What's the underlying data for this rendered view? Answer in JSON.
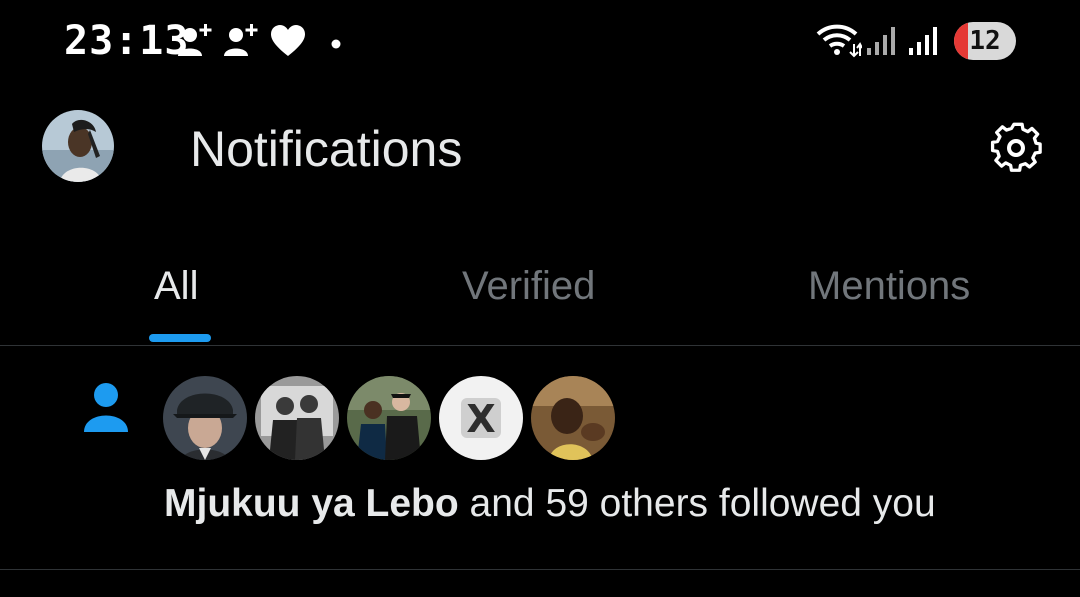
{
  "status_bar": {
    "time": "23:13",
    "battery_level": "12",
    "icons": [
      "person-add-icon",
      "person-add-icon",
      "heart-icon",
      "dot-icon",
      "wifi-icon",
      "signal-icon",
      "signal-icon",
      "battery-icon"
    ]
  },
  "header": {
    "title": "Notifications",
    "icons": [
      "avatar",
      "gear-icon"
    ]
  },
  "tabs": [
    {
      "label": "All",
      "active": true
    },
    {
      "label": "Verified",
      "active": false
    },
    {
      "label": "Mentions",
      "active": false
    }
  ],
  "notification": {
    "icon": "person-icon",
    "name": "Mjukuu ya Lebo",
    "message": " and 59 others followed you",
    "avatars": [
      "avatar-1",
      "avatar-2",
      "avatar-3",
      "avatar-x",
      "avatar-5"
    ]
  },
  "colors": {
    "background": "#000000",
    "accent": "#1d9bf0",
    "text_primary": "#e7e9ea",
    "text_secondary": "#71767b",
    "battery_low": "#e53935"
  }
}
